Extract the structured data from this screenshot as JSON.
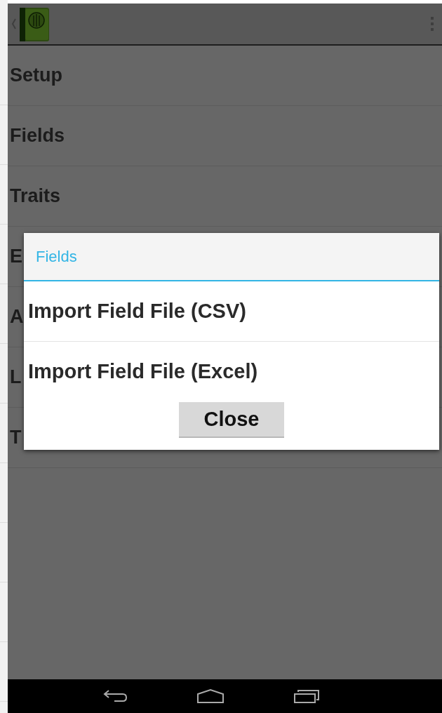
{
  "menu_items": [
    {
      "label": "Setup"
    },
    {
      "label": "Fields"
    },
    {
      "label": "Traits"
    },
    {
      "label": "E"
    },
    {
      "label": "A"
    },
    {
      "label": "L"
    },
    {
      "label": "T"
    }
  ],
  "dialog": {
    "title": "Fields",
    "options": [
      {
        "label": "Import Field File (CSV)"
      },
      {
        "label": "Import Field File (Excel)"
      }
    ],
    "close_button": "Close"
  }
}
